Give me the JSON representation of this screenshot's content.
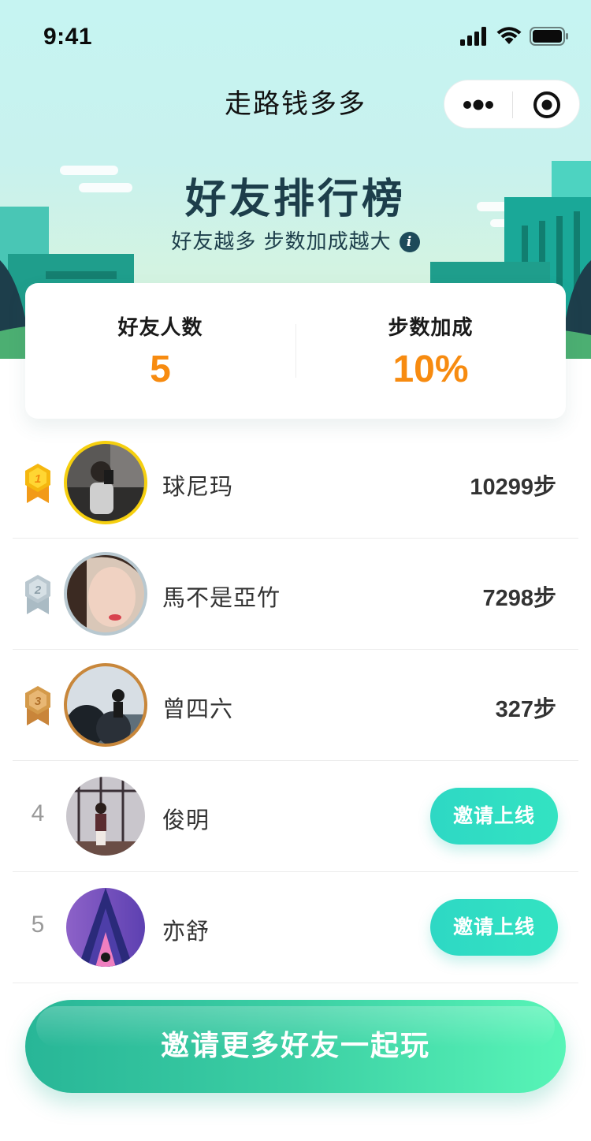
{
  "status_bar": {
    "time": "9:41"
  },
  "nav": {
    "title": "走路钱多多"
  },
  "hero": {
    "title": "好友排行榜",
    "subtitle": "好友越多 步数加成越大",
    "info_icon": "i"
  },
  "stats": {
    "friend_count_label": "好友人数",
    "friend_count_value": "5",
    "bonus_label": "步数加成",
    "bonus_value": "10%"
  },
  "colors": {
    "accent_orange": "#f78b10",
    "teal": "#2ed8c4",
    "gold": "#f5c518",
    "silver": "#b5c3cc",
    "bronze": "#d49a4a"
  },
  "friends": [
    {
      "rank": "1",
      "name": "球尼玛",
      "steps": "10299步",
      "medal": "gold-medal-icon"
    },
    {
      "rank": "2",
      "name": "馬不是亞竹",
      "steps": "7298步",
      "medal": "silver-medal-icon"
    },
    {
      "rank": "3",
      "name": "曾四六",
      "steps": "327步",
      "medal": "bronze-medal-icon"
    },
    {
      "rank": "4",
      "name": "俊明",
      "action": "邀请上线"
    },
    {
      "rank": "5",
      "name": "亦舒",
      "action": "邀请上线"
    }
  ],
  "cta": {
    "label": "邀请更多好友一起玩"
  }
}
